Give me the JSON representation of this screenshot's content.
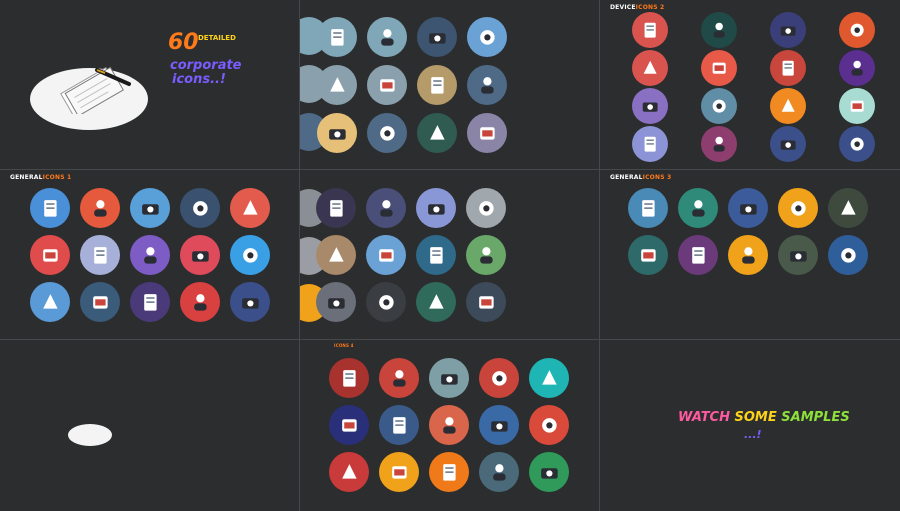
{
  "hero": {
    "number": "60",
    "detailed": "DETAILED",
    "line1": "corporate",
    "line2": "icons..!"
  },
  "device_title": {
    "a": "DEVICE",
    "b": "ICONS 2"
  },
  "general1_title": {
    "a": "GENERAL",
    "b": "ICONS 1"
  },
  "general3_title": {
    "a": "GENERAL",
    "b": "ICONS 3"
  },
  "food_title": "ICONS 4",
  "cta": {
    "watch": "WATCH",
    "some": "SOME",
    "samples": "SAMPLES",
    "dots": "...!"
  },
  "colors": {
    "bg": "#2b2d2e",
    "divider": "#46494b",
    "orange": "#ff7a1a",
    "violet": "#7a5cff",
    "yellow": "#ffd21a",
    "green": "#8ee03a",
    "pink": "#ff5aa0"
  },
  "panels": {
    "corporate": [
      {
        "name": "employee-desk-icon",
        "color": "#7fa7b7"
      },
      {
        "name": "presenter-icon",
        "color": "#7fa7b7"
      },
      {
        "name": "award-man-icon",
        "color": "#3d5570"
      },
      {
        "name": "support-agent-icon",
        "color": "#6aa2d6"
      },
      {
        "name": "presentation-board-icon",
        "color": "#8aa1ad"
      },
      {
        "name": "calendar-icon",
        "color": "#8aa1ad"
      },
      {
        "name": "coffee-cup-icon",
        "color": "#b59a6a"
      },
      {
        "name": "career-stairs-icon",
        "color": "#4e6a86"
      },
      {
        "name": "businessman-icon",
        "color": "#e6c079"
      },
      {
        "name": "network-man-icon",
        "color": "#4e6a86"
      },
      {
        "name": "hierarchy-icon",
        "color": "#2f5b51"
      },
      {
        "name": "growth-chart-icon",
        "color": "#8a84a6"
      }
    ],
    "device": [
      {
        "name": "webcam-icon",
        "color": "#d9534f"
      },
      {
        "name": "speaker-mute-icon",
        "color": "#1f4a47"
      },
      {
        "name": "speaker-icon",
        "color": "#3a3f7a"
      },
      {
        "name": "gamepad-icon",
        "color": "#e0582e"
      },
      {
        "name": "mobile-phone-icon",
        "color": "#d9534f"
      },
      {
        "name": "cordless-phone-icon",
        "color": "#e85a47"
      },
      {
        "name": "video-camera-icon",
        "color": "#c9463c"
      },
      {
        "name": "ticket-battery-icon",
        "color": "#5a2f8f"
      },
      {
        "name": "fax-machine-icon",
        "color": "#8a70c2"
      },
      {
        "name": "calculator-icon",
        "color": "#5f8ea6"
      },
      {
        "name": "microphone-icon",
        "color": "#f28a22"
      },
      {
        "name": "joystick-icon",
        "color": "#a8dcd2"
      },
      {
        "name": "mouse-icon",
        "color": "#8c93d6"
      },
      {
        "name": "printer-icon",
        "color": "#8e3e6e"
      },
      {
        "name": "cloud-computer-icon",
        "color": "#3b4f8a"
      },
      {
        "name": "server-icon",
        "color": "#3b4f8a"
      }
    ],
    "general1": [
      {
        "name": "document-icon",
        "color": "#4a90d9"
      },
      {
        "name": "wheelchair-icon",
        "color": "#e55a3c"
      },
      {
        "name": "pan-icon",
        "color": "#5aa0d8"
      },
      {
        "name": "fire-extinguisher-icon",
        "color": "#3a5270"
      },
      {
        "name": "radio-icon",
        "color": "#e35b4c"
      },
      {
        "name": "newspaper-icon",
        "color": "#e04b4b"
      },
      {
        "name": "desk-lamp-icon",
        "color": "#a7b0d8"
      },
      {
        "name": "stethoscope-icon",
        "color": "#7d5cc6"
      },
      {
        "name": "cocktail-icon",
        "color": "#e04b5c"
      },
      {
        "name": "hot-air-balloon-icon",
        "color": "#3aa0e6"
      },
      {
        "name": "padlock-icon",
        "color": "#5a9ad6"
      },
      {
        "name": "lock-safe-icon",
        "color": "#3b5b7a"
      },
      {
        "name": "medal-icon",
        "color": "#4b3a7a"
      },
      {
        "name": "eye-icon",
        "color": "#d94141"
      },
      {
        "name": "birthday-cake-icon",
        "color": "#3b4f8a"
      }
    ],
    "general2": [
      {
        "name": "magic-wand-icon",
        "color": "#3a3550"
      },
      {
        "name": "trophy-icon",
        "color": "#4a4f7a"
      },
      {
        "name": "diamond-ring-icon",
        "color": "#8a97d6"
      },
      {
        "name": "trash-bin-icon",
        "color": "#a0a8ae"
      },
      {
        "name": "hammer-icon",
        "color": "#a88a6a"
      },
      {
        "name": "scales-icon",
        "color": "#6aa2d6"
      },
      {
        "name": "pen-icon",
        "color": "#2f6a8a"
      },
      {
        "name": "shopping-cart-icon",
        "color": "#6aa86a"
      },
      {
        "name": "fuel-can-icon",
        "color": "#6a6f7a"
      },
      {
        "name": "gift-box-icon",
        "color": "#3a3d42"
      },
      {
        "name": "wall-safe-icon",
        "color": "#2f6a5a"
      },
      {
        "name": "ticket-icon",
        "color": "#3d4a5a"
      }
    ],
    "general3": [
      {
        "name": "atm-card-icon",
        "color": "#4a8ab6"
      },
      {
        "name": "money-plant-icon",
        "color": "#2f8a7a"
      },
      {
        "name": "light-bulb-icon",
        "color": "#3b5b9a"
      },
      {
        "name": "toolbox-icon",
        "color": "#f0a21a"
      },
      {
        "name": "target-icon",
        "color": "#3f4a3f"
      },
      {
        "name": "alarm-light-icon",
        "color": "#2f6a6a"
      },
      {
        "name": "cash-stack-icon",
        "color": "#6a3a7a"
      },
      {
        "name": "spray-bottle-icon",
        "color": "#f0a21a"
      },
      {
        "name": "door-icon",
        "color": "#4a5a4a"
      },
      {
        "name": "key-tag-icon",
        "color": "#2f5f9a"
      }
    ],
    "food": [
      {
        "name": "burger-icon",
        "color": "#a8322e"
      },
      {
        "name": "meal-plate-icon",
        "color": "#c9443a"
      },
      {
        "name": "hamburger-icon",
        "color": "#7f9fa6"
      },
      {
        "name": "pizza-slice-icon",
        "color": "#c9443a"
      },
      {
        "name": "sandwich-icon",
        "color": "#1fb5b5"
      },
      {
        "name": "french-fries-icon",
        "color": "#2a2f7a"
      },
      {
        "name": "popcorn-icon",
        "color": "#3a5a8a"
      },
      {
        "name": "coffee-mug-icon",
        "color": "#d9664a"
      },
      {
        "name": "soft-drink-icon",
        "color": "#3a6aa6"
      },
      {
        "name": "soup-bowl-icon",
        "color": "#d94a3a"
      },
      {
        "name": "salad-plate-icon",
        "color": "#c93a3a"
      },
      {
        "name": "fried-egg-icon",
        "color": "#f0a21a"
      },
      {
        "name": "donut-icon",
        "color": "#f07a1a"
      },
      {
        "name": "roast-chicken-icon",
        "color": "#4a6a7a"
      },
      {
        "name": "sushi-icon",
        "color": "#2f9a5a"
      }
    ]
  }
}
